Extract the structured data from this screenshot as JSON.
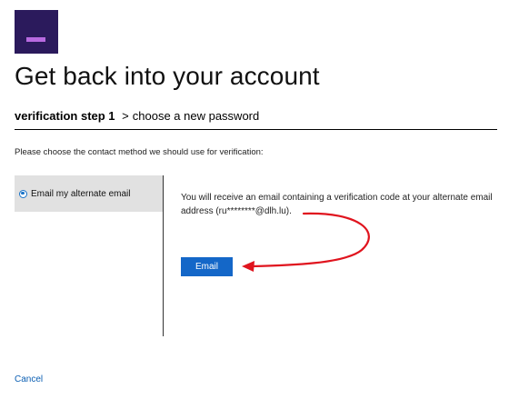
{
  "header": {
    "title": "Get back into your account"
  },
  "steps": {
    "current": "verification step 1",
    "separator": ">",
    "next": "choose a new password"
  },
  "instruction": "Please choose the contact method we should use for verification:",
  "methods": [
    {
      "label": "Email my alternate email",
      "selected": true
    }
  ],
  "detail": {
    "text": "You will receive an email containing a verification code at your alternate email address (ru********@dlh.lu)."
  },
  "actions": {
    "email_label": "Email",
    "cancel_label": "Cancel"
  },
  "colors": {
    "logo_bg": "#2b1a5c",
    "logo_accent": "#b86ae0",
    "button": "#1467c8",
    "link": "#0b5fb3",
    "annotation": "#e0141e"
  },
  "icons": {
    "logo": "logo-icon",
    "radio": "radio-selected-icon",
    "arrow": "red-arrow-annotation"
  }
}
